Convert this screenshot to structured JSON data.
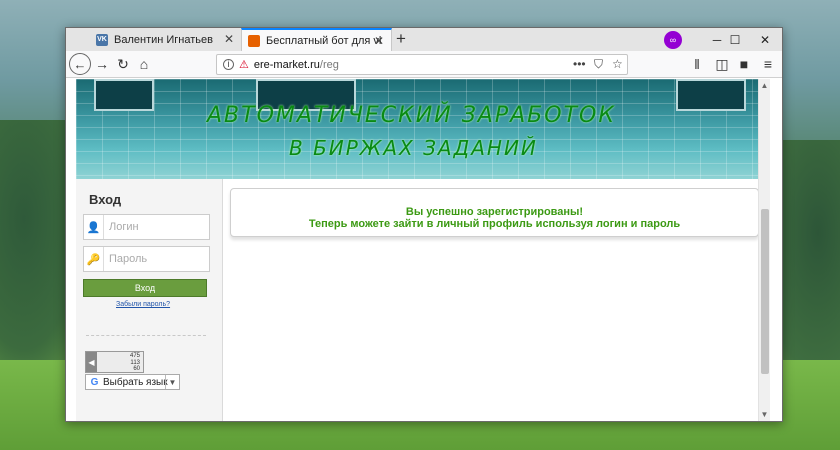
{
  "tabs": [
    {
      "title": "Валентин Игнатьев",
      "favicon": "VK",
      "active": false
    },
    {
      "title": "Бесплатный бот для vktarget и",
      "favicon": "",
      "active": true
    }
  ],
  "navbar": {
    "url_host": "ere-market.ru",
    "url_path": "/reg",
    "page_actions": "•••"
  },
  "banner": {
    "line1": "АВТОМАТИЧЕСКИЙ ЗАРАБОТОК",
    "line2": "В БИРЖАХ ЗАДАНИЙ"
  },
  "sidebar": {
    "title": "Вход",
    "login_placeholder": "Логин",
    "password_placeholder": "Пароль",
    "login_button": "Вход",
    "forgot_link": "Забыли пароль?",
    "counter": {
      "line1": "475",
      "line2": "113",
      "line3": "60"
    },
    "language_select": "Выбрать язык"
  },
  "message": {
    "line1": "Вы успешно зарегистрированы!",
    "line2": "Теперь можете зайти в личный профиль используя логин и пароль"
  },
  "colors": {
    "success_text": "#3c9a14",
    "button_green": "#6a9d3e",
    "banner_title": "#0a8a14",
    "tab_accent": "#0a84ff"
  }
}
